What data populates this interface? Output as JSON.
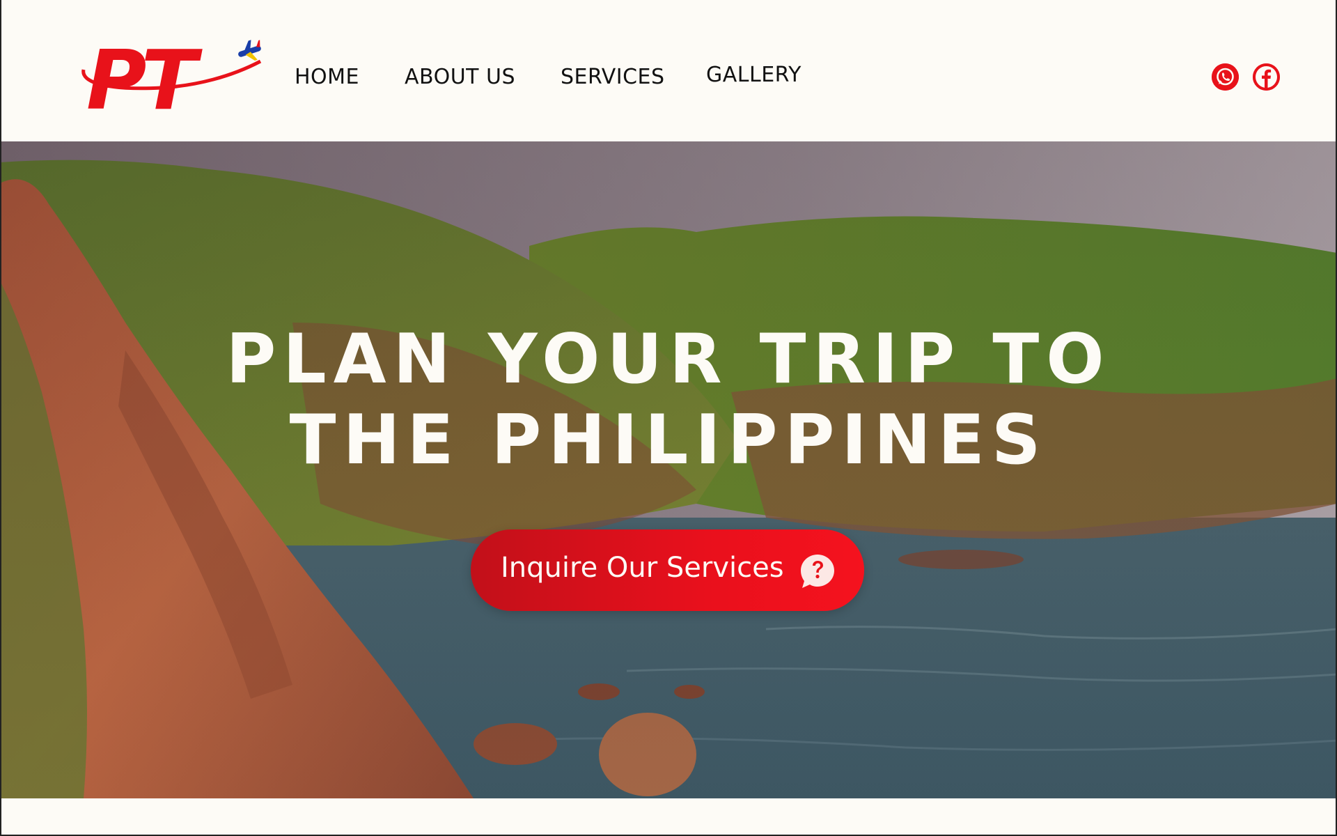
{
  "brand": {
    "logo_text": "PT",
    "colors": {
      "primary_red": "#e8121a",
      "background": "#fdfbf6",
      "text_dark": "#111111"
    }
  },
  "nav": {
    "items": [
      {
        "label": "HOME"
      },
      {
        "label": "ABOUT US"
      },
      {
        "label": "SERVICES"
      },
      {
        "label": "GALLERY"
      }
    ]
  },
  "social": {
    "icons": [
      "whatsapp-icon",
      "facebook-icon"
    ]
  },
  "hero": {
    "title_line1": "PLAN YOUR TRIP TO",
    "title_line2": "THE PHILIPPINES",
    "background": "coastal-cliffs-photo",
    "cta": {
      "label": "Inquire Our Services",
      "icon": "question-chat-icon"
    }
  }
}
